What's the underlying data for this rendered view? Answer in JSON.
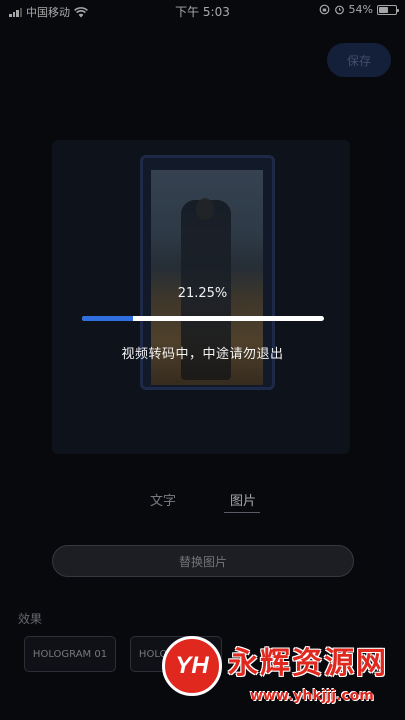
{
  "status_bar": {
    "carrier": "中国移动",
    "time": "下午 5:03",
    "battery_percent": "54%",
    "battery_level": 0.54
  },
  "header": {
    "save_label": "保存"
  },
  "progress": {
    "percent_text": "21.25%",
    "value": 0.2125,
    "message": "视频转码中，中途请勿退出"
  },
  "tabs": [
    {
      "label": "文字"
    },
    {
      "label": "图片",
      "active": true
    }
  ],
  "replace_button_label": "替换图片",
  "effects": {
    "label": "效果",
    "options": [
      "HOLOGRAM 01",
      "HOLOGRAM 02"
    ]
  },
  "watermark": {
    "logo_text": "YH",
    "title": "永辉资源网",
    "url": "www.yhkjjj.com"
  },
  "colors": {
    "accent": "#2f6fe0",
    "watermark": "#e0281f",
    "background": "#0b0d13"
  }
}
